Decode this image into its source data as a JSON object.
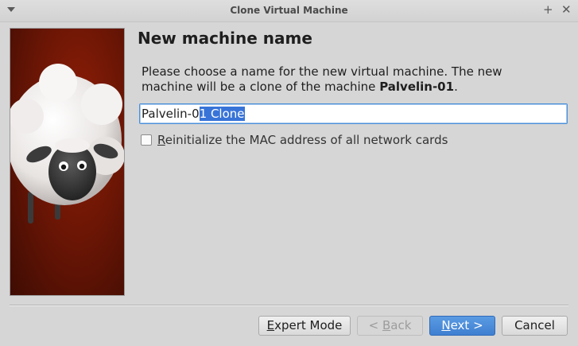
{
  "window": {
    "title": "Clone Virtual Machine",
    "maximize_glyph": "+",
    "close_glyph": "✕"
  },
  "page": {
    "heading": "New machine name",
    "description_prefix": "Please choose a name for the new virtual machine. The new machine will be a clone of the machine ",
    "source_machine": "Palvelin-01",
    "description_suffix": "."
  },
  "name_field": {
    "value_unselected": "Palvelin-0",
    "value_selected": "1 Clone",
    "full_value": "Palvelin-01 Clone"
  },
  "mac_option": {
    "mnemonic": "R",
    "label_rest": "einitialize the MAC address of all network cards",
    "checked": false
  },
  "buttons": {
    "expert_mnemonic": "E",
    "expert_rest": "xpert Mode",
    "back_prefix": "< ",
    "back_mnemonic": "B",
    "back_rest": "ack",
    "next_mnemonic": "N",
    "next_rest": "ext >",
    "cancel_label": "Cancel"
  },
  "colors": {
    "accent": "#3f7fd0",
    "selection": "#3874d8",
    "side_art_bg": "#6d1605"
  },
  "icons": {
    "window_menu": "chevron-down-icon",
    "side_art": "sheep-illustration"
  }
}
